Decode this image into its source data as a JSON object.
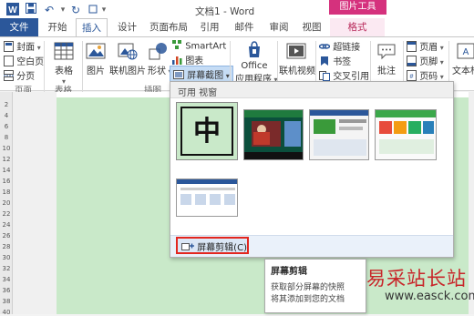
{
  "window": {
    "title": "文档1 - Word",
    "context_group": "图片工具"
  },
  "tabs": [
    "文件",
    "开始",
    "插入",
    "设计",
    "页面布局",
    "引用",
    "邮件",
    "审阅",
    "视图",
    "格式"
  ],
  "ribbon": {
    "pages": {
      "cover": "封面",
      "blank": "空白页",
      "break": "分页",
      "label": "页面"
    },
    "tables": {
      "table": "表格",
      "label": "表格"
    },
    "illustrations": {
      "picture": "图片",
      "online_picture": "联机图片",
      "shapes": "形状",
      "smartart": "SmartArt",
      "chart": "图表",
      "screenshot": "屏幕截图",
      "label": "插图"
    },
    "apps": {
      "office_line1": "Office",
      "office_line2": "应用程序"
    },
    "media": {
      "online_video": "联机视频"
    },
    "links": {
      "hyperlink": "超链接",
      "bookmark": "书签",
      "cross_ref": "交叉引用"
    },
    "comments": {
      "comment": "批注"
    },
    "header_footer": {
      "header": "页眉",
      "footer": "页脚",
      "page_number": "页码"
    },
    "text": {
      "textbox": "文本框"
    }
  },
  "dropdown": {
    "header": "可用 视窗",
    "thumb_char": "中",
    "footer_item": "屏幕剪辑(C)"
  },
  "ruler_numbers": [
    "2",
    "4",
    "6",
    "8",
    "10",
    "12",
    "14",
    "16",
    "18",
    "20",
    "22",
    "24",
    "26",
    "28",
    "30",
    "32",
    "34",
    "36",
    "38",
    "40"
  ],
  "tooltip": {
    "title": "屏幕剪辑",
    "line1": "获取部分屏幕的快照",
    "line2": "将其添加到您的文档"
  },
  "watermark": {
    "text": "易采站长站",
    "url": "www.easck.com"
  },
  "colors": {
    "accent": "#2b579a",
    "context_tab": "#d5317d",
    "highlight_border": "#e3261f",
    "document_bg": "#c9e9c9"
  }
}
